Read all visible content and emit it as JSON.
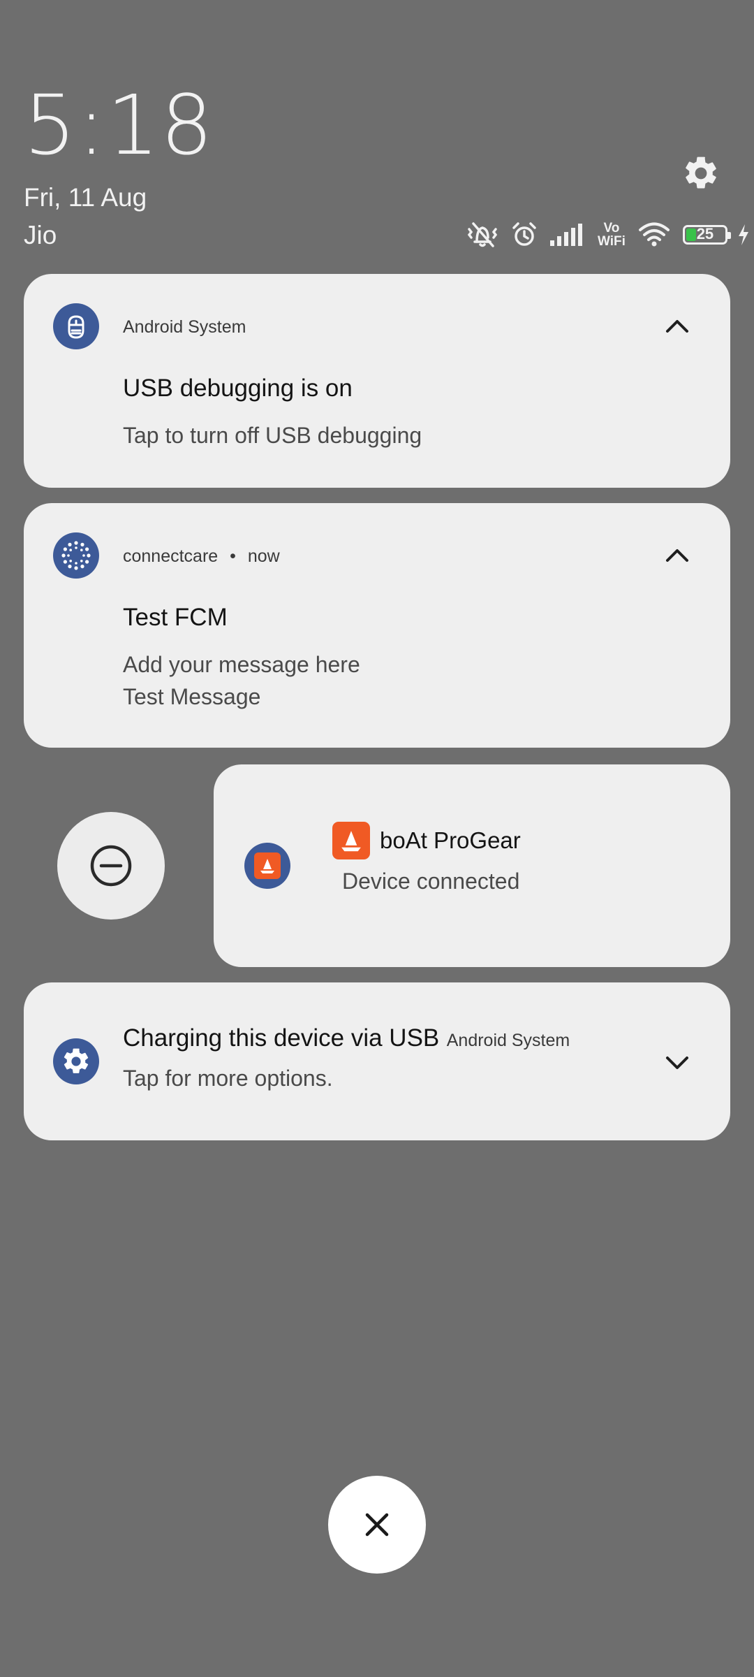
{
  "status": {
    "time": "5:18",
    "date": "Fri, 11 Aug",
    "carrier": "Jio",
    "vowifi_line1": "Vo",
    "vowifi_line2": "WiFi",
    "battery_level": "25",
    "battery_fraction": 0.25,
    "icons": [
      "settings-gear-icon",
      "vibrate-off-icon",
      "alarm-icon",
      "signal-icon",
      "vowifi-icon",
      "wifi-icon",
      "battery-icon",
      "charging-bolt-icon"
    ]
  },
  "notifications": [
    {
      "app": "Android System",
      "title": "USB debugging is on",
      "text": "Tap to turn off USB debugging",
      "icon": "usb-debug-icon",
      "expanded": true
    },
    {
      "app": "connectcare",
      "separator": "•",
      "time": "now",
      "title": "Test FCM",
      "text_line1": "Add your message here",
      "text_line2": "Test Message",
      "icon": "connectcare-icon",
      "expanded": true
    },
    {
      "title": "boAt ProGear",
      "text": "Device connected",
      "icon": "boat-app-icon"
    },
    {
      "title": "Charging this device via USB",
      "app": "Android System",
      "text": "Tap for more options.",
      "icon": "settings-icon",
      "expanded": false
    }
  ],
  "colors": {
    "background": "#6e6e6e",
    "card": "#efefef",
    "app_icon_bg": "#3d5a98",
    "boat_orange": "#f05a24"
  }
}
